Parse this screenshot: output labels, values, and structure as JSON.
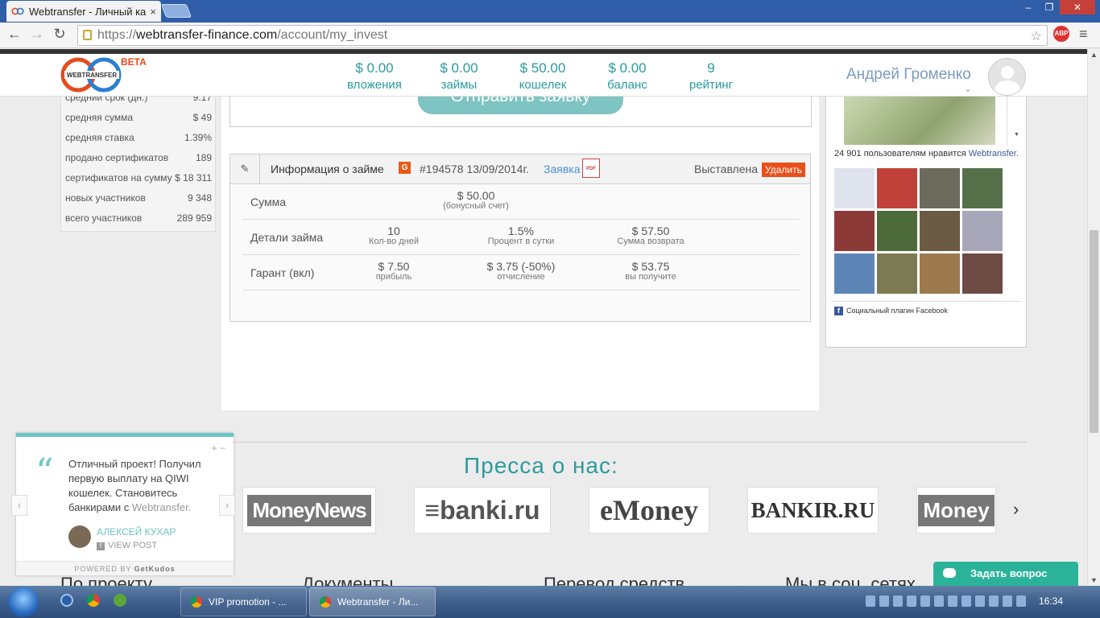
{
  "browser": {
    "tab_title": "Webtransfer - Личный ка",
    "tab_close": "×",
    "url_scheme": "https://",
    "url_domain": "webtransfer-finance.com",
    "url_path": "/account/my_invest",
    "abp_label": "ABP",
    "window_buttons": {
      "minimize": "‒",
      "maximize": "❐",
      "close": "✕"
    }
  },
  "header": {
    "beta": "BETA",
    "stats": [
      {
        "value": "$ 0.00",
        "label": "вложения"
      },
      {
        "value": "$ 0.00",
        "label": "займы"
      },
      {
        "value": "$ 50.00",
        "label": "кошелек"
      },
      {
        "value": "$ 0.00",
        "label": "баланс"
      },
      {
        "value": "9",
        "label": "рейтинг"
      }
    ],
    "user_name": "Андрей Громенко",
    "chevron": "⌄"
  },
  "left_stats": [
    {
      "label": "средний срок (дн.)",
      "value": "9.17"
    },
    {
      "label": "средняя сумма",
      "value": "$ 49"
    },
    {
      "label": "средняя ставка",
      "value": "1.39%"
    },
    {
      "label": "продано сертификатов",
      "value": "189"
    },
    {
      "label": "сертификатов на сумму",
      "value": "$ 18 311"
    },
    {
      "label": "новых участников",
      "value": "9 348"
    },
    {
      "label": "всего участников",
      "value": "289 959"
    }
  ],
  "send_button": "Отправить заявку",
  "loan": {
    "pencil": "✎",
    "title": "Информация о займе",
    "badge": "G",
    "id_date": "#194578 13/09/2014г.",
    "request_link": "Заявка",
    "pdf": "PDF",
    "status": "Выставлена",
    "delete": "Удалить",
    "rows": [
      {
        "name": "Сумма",
        "cells": [
          {
            "v": "$ 50.00",
            "s": "(бонусный счет)"
          }
        ]
      },
      {
        "name": "Детали займа",
        "cells": [
          {
            "v": "10",
            "s": "Кол-во дней"
          },
          {
            "v": "1.5%",
            "s": "Процент в сутки"
          },
          {
            "v": "$ 57.50",
            "s": "Сумма возврата"
          }
        ]
      },
      {
        "name": "Гарант (вкл)",
        "cells": [
          {
            "v": "$ 7.50",
            "s": "прибыль"
          },
          {
            "v": "$ 3.75 (-50%)",
            "s": "отчисление"
          },
          {
            "v": "$ 53.75",
            "s": "вы получите"
          }
        ]
      }
    ]
  },
  "facebook": {
    "likes_prefix": "24 901 пользователям нравится",
    "likes_link": "Webtransfer.",
    "footer": "Социальный плагин Facebook",
    "f": "f"
  },
  "press": {
    "title": "Пресса о нас:",
    "logos": [
      "MoneyNews",
      "≡banki.ru",
      "eMoney",
      "BANKIR.RU",
      "Money"
    ],
    "next": "›"
  },
  "footer_links": [
    "По проекту",
    "Документы",
    "Перевод средств",
    "Мы в соц. сетях"
  ],
  "kudos": {
    "quote_mark": "“",
    "plus_minus": "+ −",
    "text_main": "Отличный проект! Получил первую выплату на QIWI кошелек. Становитесь банкирами с ",
    "text_tail": "Webtransfer.",
    "prev": "‹",
    "next": "›",
    "author": "АЛЕКСЕЙ КУХАР",
    "fb": "f",
    "view": "VIEW POST",
    "powered_prefix": "POWERED BY ",
    "powered_brand": "GetKudos"
  },
  "ask_button": "Задать вопрос",
  "taskbar": {
    "items": [
      {
        "label": "VIP promotion - ..."
      },
      {
        "label": "Webtransfer - Ли..."
      }
    ],
    "clock": "16:34"
  }
}
